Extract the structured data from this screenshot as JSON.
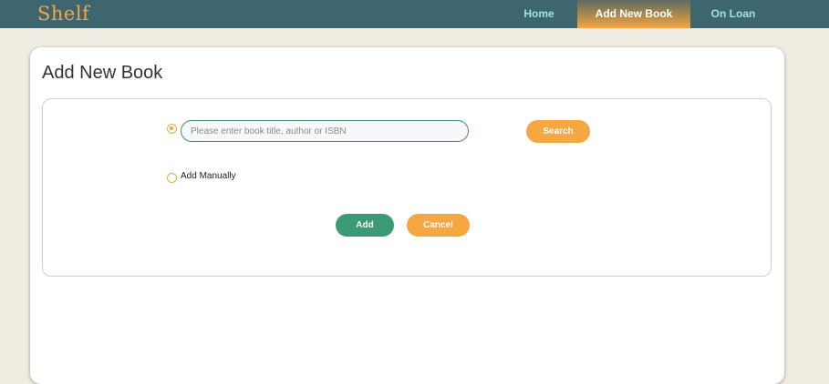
{
  "app": {
    "logo_text": "Shelf"
  },
  "nav": {
    "home": "Home",
    "add_new_book": "Add New Book",
    "on_loan": "On Loan",
    "active": "Add New Book"
  },
  "page": {
    "title": "Add New Book"
  },
  "form": {
    "search_placeholder": "Please enter book title, author or ISBN",
    "search_value": "",
    "search_button": "Search",
    "search_option_selected": true,
    "manual_label": "Add Manually",
    "manual_option_selected": false,
    "add_button": "Add",
    "cancel_button": "Cancel"
  },
  "colors": {
    "navbar": "#3e666e",
    "accent_orange": "#f5a742",
    "accent_green": "#3a9a73",
    "nav_text": "#9be6e0",
    "background": "#f2ede2"
  }
}
